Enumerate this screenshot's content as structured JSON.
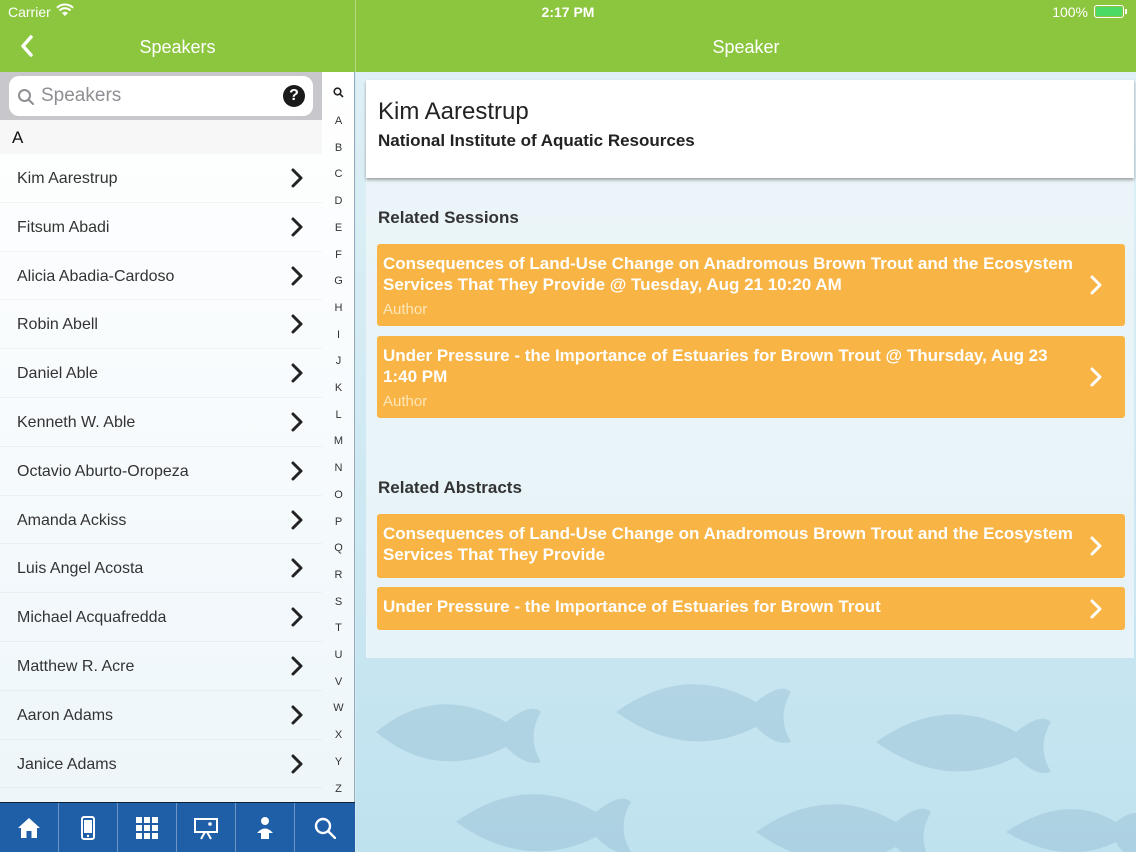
{
  "status_bar": {
    "carrier": "Carrier",
    "time": "2:17 PM",
    "battery": "100%"
  },
  "nav": {
    "left_title": "Speakers",
    "right_title": "Speaker"
  },
  "search": {
    "placeholder": "Speakers",
    "help_label": "?"
  },
  "section_letter": "A",
  "speakers": [
    "Kim Aarestrup",
    "Fitsum Abadi",
    "Alicia Abadia-Cardoso",
    "Robin Abell",
    "Daniel Able",
    "Kenneth W. Able",
    "Octavio Aburto-Oropeza",
    "Amanda Ackiss",
    "Luis Angel Acosta",
    "Michael Acquafredda",
    "Matthew R. Acre",
    "Aaron Adams",
    "Janice Adams"
  ],
  "index_letters": [
    "A",
    "B",
    "C",
    "D",
    "E",
    "F",
    "G",
    "H",
    "I",
    "J",
    "K",
    "L",
    "M",
    "N",
    "O",
    "P",
    "Q",
    "R",
    "S",
    "T",
    "U",
    "V",
    "W",
    "X",
    "Y",
    "Z"
  ],
  "tabs": [
    "home-icon",
    "mobile-icon",
    "grid-icon",
    "presentation-icon",
    "speaker-icon",
    "search-icon"
  ],
  "speaker": {
    "name": "Kim Aarestrup",
    "organization": "National Institute of Aquatic Resources"
  },
  "related_sessions_title": "Related Sessions",
  "related_sessions": [
    {
      "title": "Consequences of Land-Use Change on Anadromous Brown Trout and the Ecosystem Services That They Provide @ Tuesday, Aug 21 10:20 AM",
      "role": "Author"
    },
    {
      "title": "Under Pressure - the Importance of Estuaries for Brown Trout @ Thursday, Aug 23 1:40 PM",
      "role": "Author"
    }
  ],
  "related_abstracts_title": "Related Abstracts",
  "related_abstracts": [
    {
      "title": "Consequences of Land-Use Change on Anadromous Brown Trout and the Ecosystem Services That They Provide"
    },
    {
      "title": "Under Pressure - the Importance of Estuaries for Brown Trout"
    }
  ],
  "colors": {
    "nav_green": "#8cc63f",
    "card_orange": "#f8b445",
    "tabbar_blue": "#1f5fa8"
  }
}
